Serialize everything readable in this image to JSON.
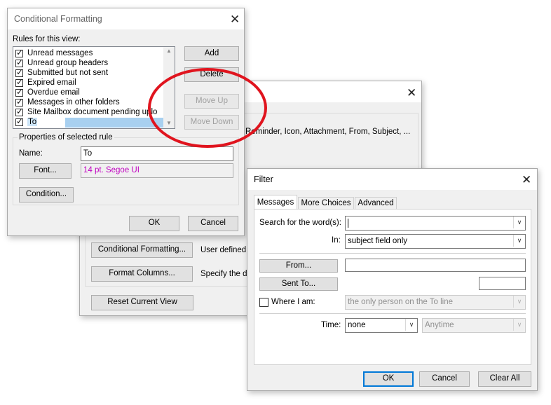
{
  "middle_dialog": {
    "desc_line": "Reminder, Icon, Attachment, From, Subject, ...",
    "conditional_formatting_button": "Conditional Formatting...",
    "conditional_formatting_desc": "User defined",
    "format_columns_button": "Format Columns...",
    "format_columns_desc": "Specify the d",
    "reset_button": "Reset Current View"
  },
  "cf_dialog": {
    "title": "Conditional Formatting",
    "rules_label": "Rules for this view:",
    "rules": [
      {
        "label": "Unread messages",
        "checked": true
      },
      {
        "label": "Unread group headers",
        "checked": true
      },
      {
        "label": "Submitted but not sent",
        "checked": true
      },
      {
        "label": "Expired email",
        "checked": true
      },
      {
        "label": "Overdue email",
        "checked": true
      },
      {
        "label": "Messages in other folders",
        "checked": true
      },
      {
        "label": "Site Mailbox document pending uplo",
        "checked": true
      },
      {
        "label": "To",
        "checked": true
      }
    ],
    "add_button": "Add",
    "delete_button": "Delete",
    "move_up_button": "Move Up",
    "move_down_button": "Move Down",
    "properties_label": "Properties of selected rule",
    "name_label": "Name:",
    "name_value": "To",
    "font_button": "Font...",
    "font_preview": "14 pt. Segoe UI",
    "font_preview_color": "#c000c0",
    "condition_button": "Condition...",
    "ok_button": "OK",
    "cancel_button": "Cancel",
    "annotation_color": "#e0141e"
  },
  "filter_dialog": {
    "title": "Filter",
    "tabs": [
      {
        "label": "Messages",
        "active": true
      },
      {
        "label": "More Choices",
        "active": false
      },
      {
        "label": "Advanced",
        "active": false
      }
    ],
    "search_label": "Search for the word(s):",
    "search_value": "",
    "in_label": "In:",
    "in_value": "subject field only",
    "from_button": "From...",
    "from_value": "",
    "sent_to_button": "Sent To...",
    "sent_to_value": "",
    "where_label": "Where I am:",
    "where_checked": false,
    "where_value": "the only person on the To line",
    "time_label": "Time:",
    "time_value": "none",
    "time_range_value": "Anytime",
    "ok_button": "OK",
    "cancel_button": "Cancel",
    "clear_button": "Clear All"
  }
}
